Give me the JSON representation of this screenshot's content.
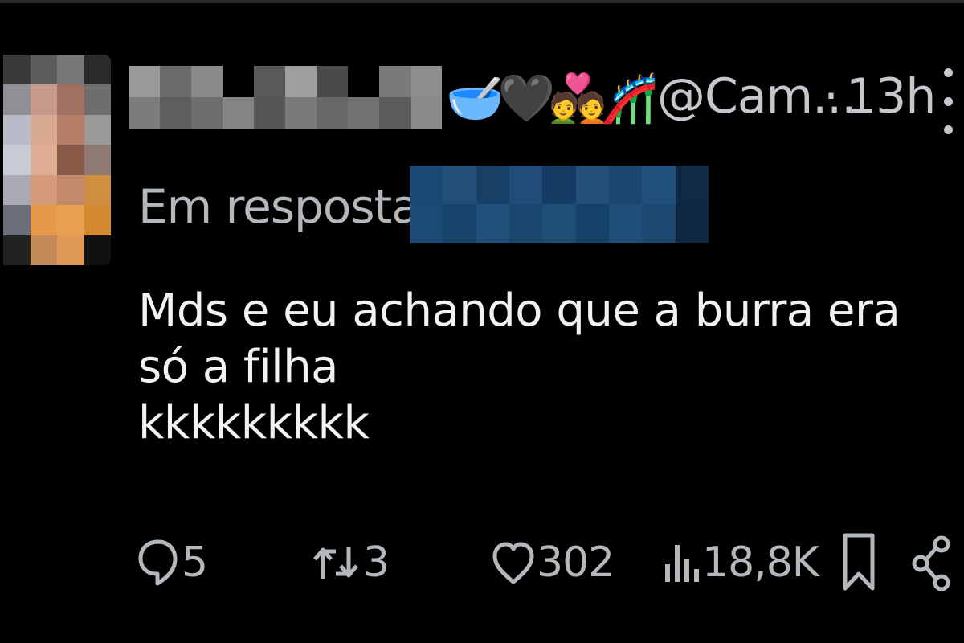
{
  "post": {
    "author_emojis": [
      "🥣",
      "🖤",
      "💑",
      "🎢"
    ],
    "handle": "@Cam...",
    "separator": "·",
    "time": "13h",
    "reply_prefix": "Em resposta a",
    "text": "Mds e eu achando que a burra era só a filha\nkkkkkkkkk"
  },
  "actions": {
    "replies": "5",
    "reposts": "3",
    "likes": "302",
    "views": "18,8K"
  },
  "icons": {
    "reply": "speech-bubble-icon",
    "repost": "repost-arrows-icon",
    "like": "heart-icon",
    "views": "bar-chart-icon",
    "bookmark": "bookmark-icon",
    "share": "share-icon",
    "more": "vertical-dots-icon"
  },
  "colors": {
    "background": "#000000",
    "text": "#f0f2f3",
    "secondary": "#b3b8bd",
    "mention_blur": "#1d4f7a"
  }
}
